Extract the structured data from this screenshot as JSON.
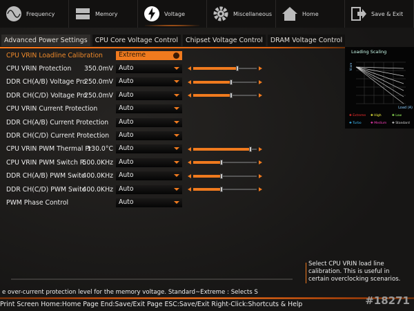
{
  "nav": [
    {
      "label": "Frequency",
      "icon": "frequency-icon"
    },
    {
      "label": "Memory",
      "icon": "memory-icon"
    },
    {
      "label": "Voltage",
      "icon": "voltage-icon",
      "active": true
    },
    {
      "label": "Miscellaneous",
      "icon": "gear-icon"
    },
    {
      "label": "Home",
      "icon": "home-icon"
    },
    {
      "label": "Save & Exit",
      "icon": "exit-icon"
    }
  ],
  "tabs": [
    "Advanced Power Settings",
    "CPU Core Voltage Control",
    "Chipset Voltage Control",
    "DRAM Voltage Control"
  ],
  "rows": [
    {
      "label": "CPU VRIN Loadline Calibration",
      "value": "",
      "option": "Extreme",
      "selected": true
    },
    {
      "label": "CPU VRIN Protection",
      "value": "350.0mV",
      "option": "Auto",
      "slider": 0.7
    },
    {
      "label": "DDR CH(A/B) Voltage Pro",
      "value": "250.0mV",
      "option": "Auto",
      "slider": 0.6
    },
    {
      "label": "DDR CH(C/D) Voltage Pro",
      "value": "250.0mV",
      "option": "Auto",
      "slider": 0.6
    },
    {
      "label": "CPU VRIN Current Protection",
      "value": "",
      "option": "Auto"
    },
    {
      "label": "DDR CH(A/B) Current Protection",
      "value": "",
      "option": "Auto"
    },
    {
      "label": "DDR CH(C/D) Current Protection",
      "value": "",
      "option": "Auto"
    },
    {
      "label": "CPU VRIN PWM Thermal Pr",
      "value": "130.0°C",
      "option": "Auto",
      "slider": 0.9
    },
    {
      "label": "CPU VRIN PWM Switch R:",
      "value": "500.0KHz",
      "option": "Auto",
      "slider": 0.45
    },
    {
      "label": "DDR CH(A/B) PWM Switc",
      "value": "400.0KHz",
      "option": "Auto",
      "slider": 0.45
    },
    {
      "label": "DDR CH(C/D) PWM Switc",
      "value": "400.0KHz",
      "option": "Auto",
      "slider": 0.45
    },
    {
      "label": "PWM Phase Control",
      "value": "",
      "option": "Auto"
    }
  ],
  "chart": {
    "title": "Loading Scaling",
    "ylabel": "Vcore",
    "xlabel": "Load (A)",
    "legend": [
      {
        "label": "Extreme",
        "color": "#ff3030"
      },
      {
        "label": "High",
        "color": "#ffff40"
      },
      {
        "label": "Low",
        "color": "#a0ff60"
      },
      {
        "label": "Turbo",
        "color": "#40c0ff"
      },
      {
        "label": "Medium",
        "color": "#ff40c0"
      },
      {
        "label": "Standard",
        "color": "#dddddd"
      }
    ]
  },
  "help": "Select CPU VRIN load line calibration. This is useful in certain overclocking scenarios.",
  "description": "e over-current protection level for the memory voltage. Standard~Extreme : Selects S",
  "footer": "Print Screen Home:Home Page End:Save/Exit Page ESC:Save/Exit Right-Click:Shortcuts & Help",
  "code": "#18271"
}
